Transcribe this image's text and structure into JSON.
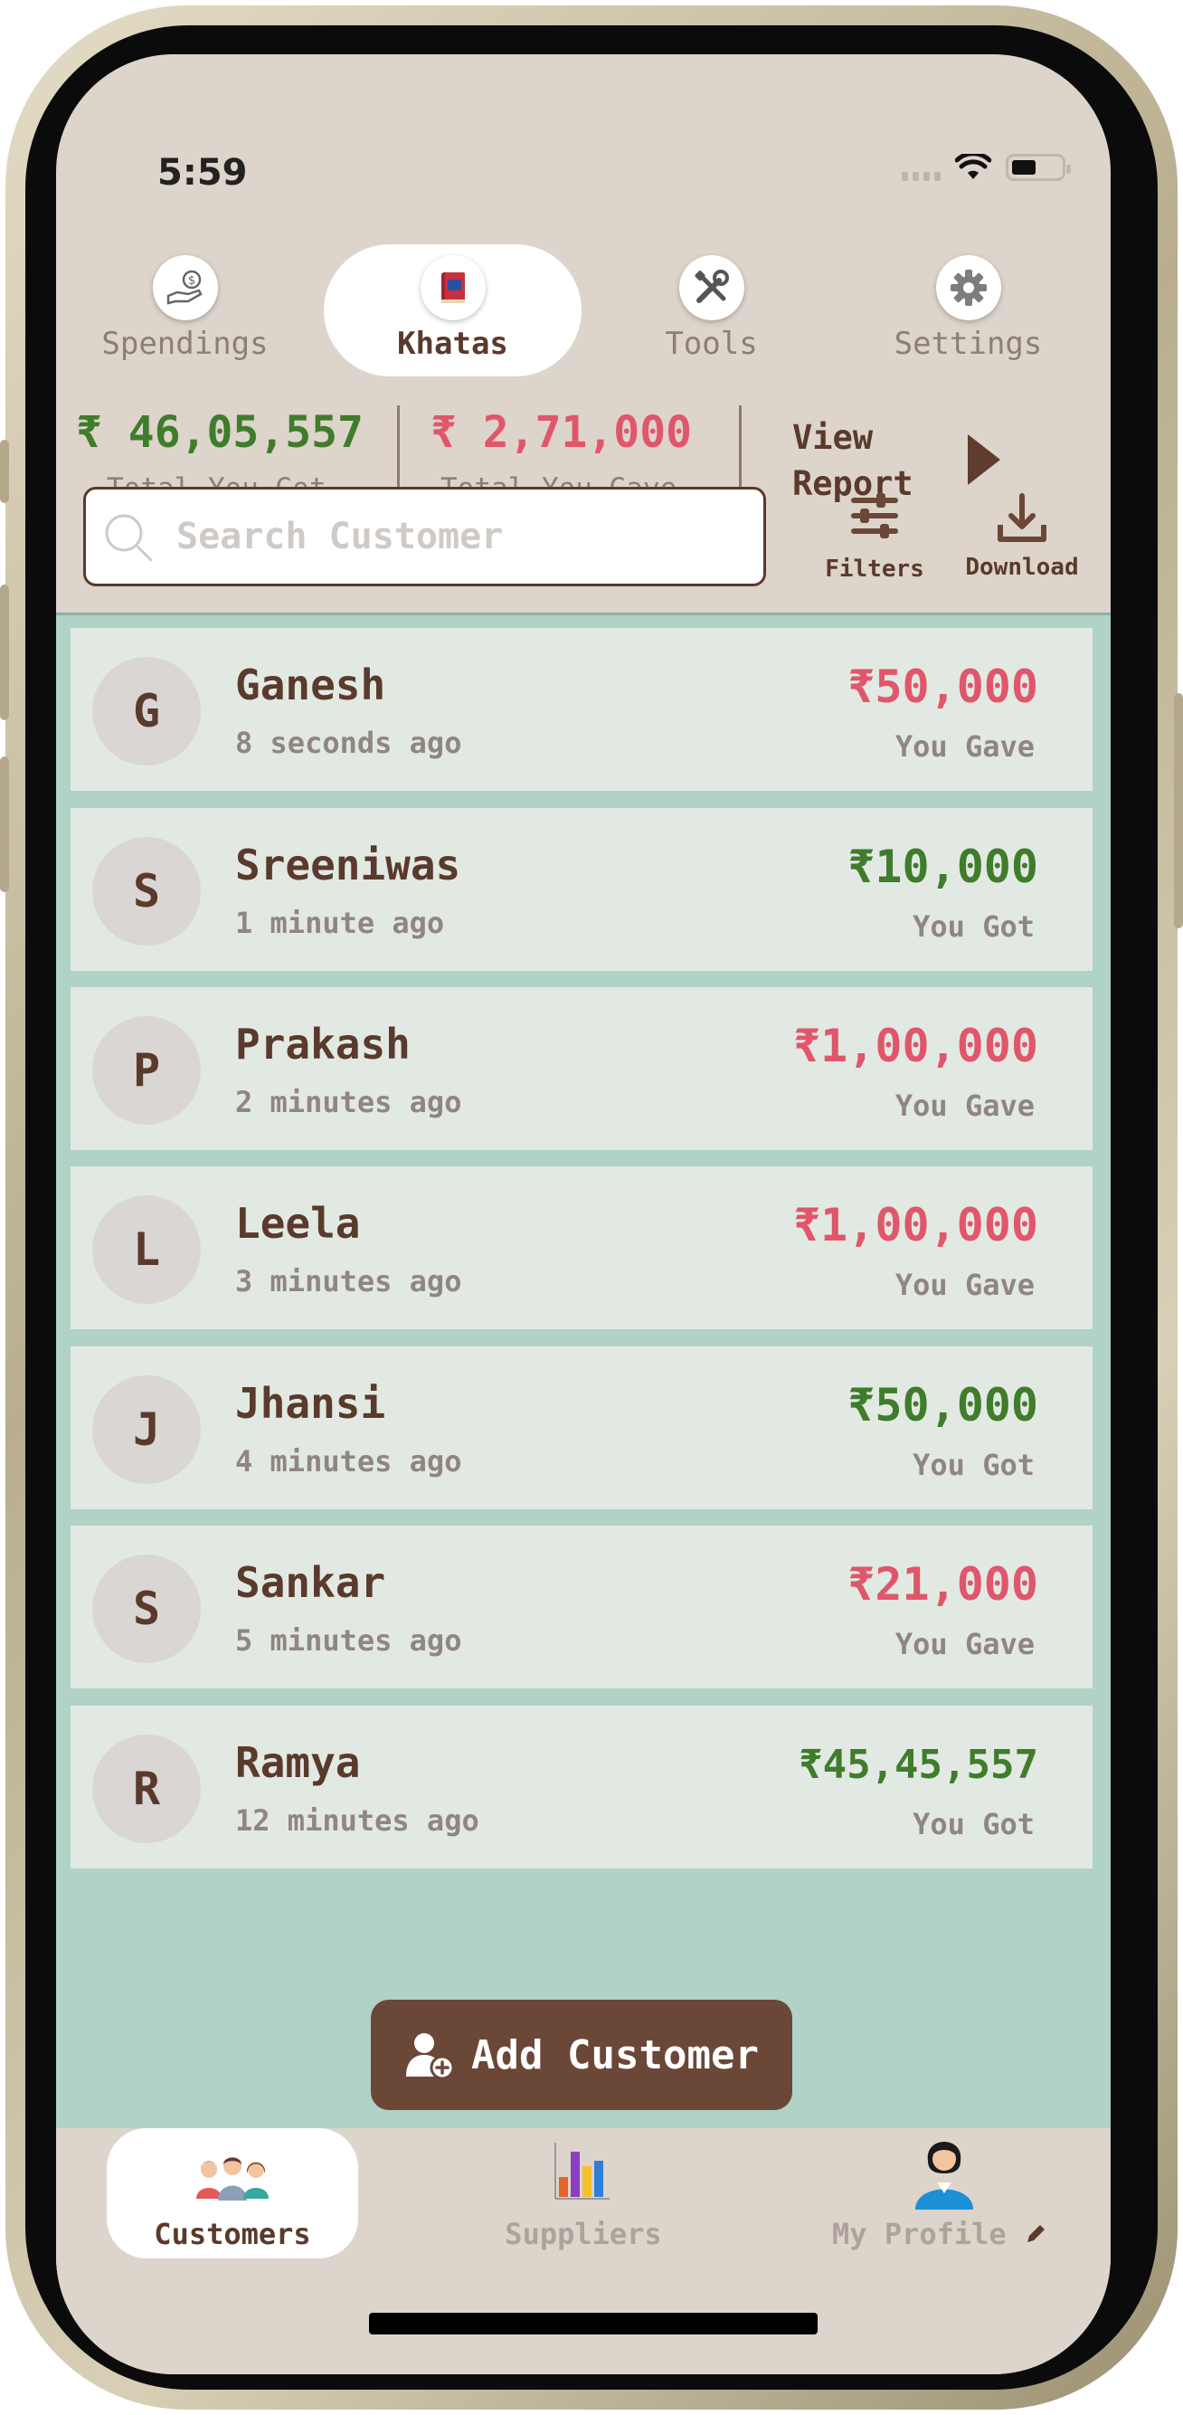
{
  "status_bar": {
    "time": "5:59"
  },
  "top_tabs": [
    {
      "label": "Spendings",
      "icon": "money-hand-icon",
      "active": false
    },
    {
      "label": "Khatas",
      "icon": "ledger-book-icon",
      "active": true
    },
    {
      "label": "Tools",
      "icon": "tools-icon",
      "active": false
    },
    {
      "label": "Settings",
      "icon": "gear-icon",
      "active": false
    }
  ],
  "summary": {
    "total_got": "₹ 46,05,557",
    "total_got_label": "Total You Got",
    "total_gave": "₹ 2,71,000",
    "total_gave_label": "Total You Gave",
    "view_report_line1": "View",
    "view_report_line2": "Report"
  },
  "search": {
    "placeholder": "Search Customer"
  },
  "actions": {
    "filters_label": "Filters",
    "download_label": "Download"
  },
  "customers": [
    {
      "initial": "G",
      "name": "Ganesh",
      "time": "8 seconds ago",
      "amount": "₹50,000",
      "direction": "You Gave"
    },
    {
      "initial": "S",
      "name": "Sreeniwas",
      "time": "1 minute ago",
      "amount": "₹10,000",
      "direction": "You Got"
    },
    {
      "initial": "P",
      "name": "Prakash",
      "time": "2 minutes ago",
      "amount": "₹1,00,000",
      "direction": "You Gave"
    },
    {
      "initial": "L",
      "name": "Leela",
      "time": "3 minutes ago",
      "amount": "₹1,00,000",
      "direction": "You Gave"
    },
    {
      "initial": "J",
      "name": "Jhansi",
      "time": "4 minutes ago",
      "amount": "₹50,000",
      "direction": "You Got"
    },
    {
      "initial": "S",
      "name": "Sankar",
      "time": "5 minutes ago",
      "amount": "₹21,000",
      "direction": "You Gave"
    },
    {
      "initial": "R",
      "name": "Ramya",
      "time": "12 minutes ago",
      "amount": "₹45,45,557",
      "direction": "You Got"
    }
  ],
  "add_customer": {
    "label": "Add Customer"
  },
  "bottom_nav": [
    {
      "label": "Customers",
      "icon": "customers-group-icon",
      "active": true
    },
    {
      "label": "Suppliers",
      "icon": "bar-chart-icon",
      "active": false
    },
    {
      "label": "My Profile",
      "icon": "profile-avatar-icon",
      "active": false
    }
  ],
  "colors": {
    "brown": "#5a3a2c",
    "got_green": "#3f7c2b",
    "gave_red": "#e0566a",
    "list_bg": "#b1d2c6",
    "row_bg": "#e2e9e3",
    "screen_bg": "#ddd4cb"
  }
}
